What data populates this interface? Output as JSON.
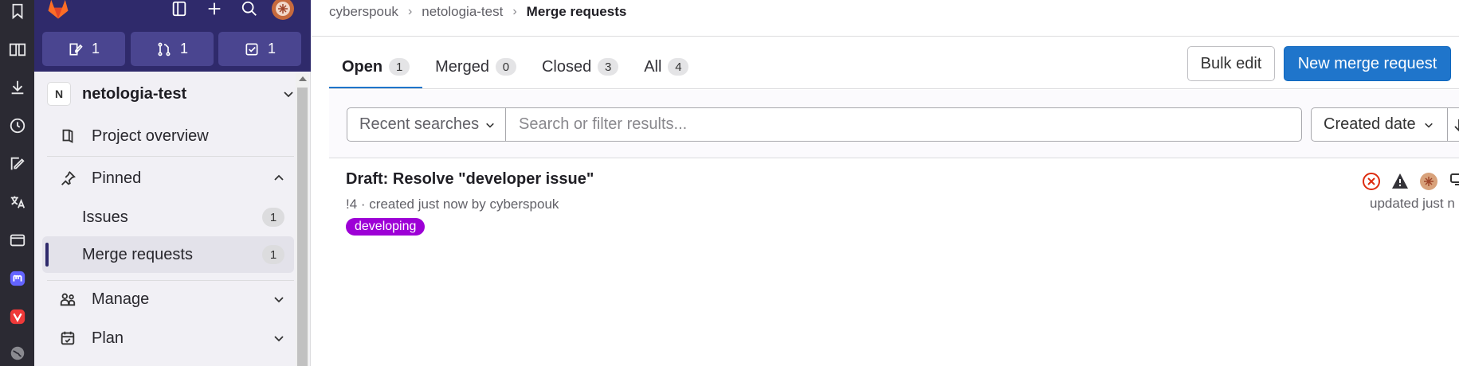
{
  "sidebar": {
    "counters": [
      {
        "icon": "issues-icon",
        "count": "1"
      },
      {
        "icon": "merge-request-icon",
        "count": "1"
      },
      {
        "icon": "todo-icon",
        "count": "1"
      }
    ],
    "project": {
      "avatar_letter": "N",
      "name": "netologia-test"
    },
    "items": {
      "overview": "Project overview",
      "pinned": "Pinned",
      "issues": "Issues",
      "issues_count": "1",
      "merge_requests": "Merge requests",
      "merge_requests_count": "1",
      "manage": "Manage",
      "plan": "Plan"
    }
  },
  "breadcrumb": [
    "cyberspouk",
    "netologia-test",
    "Merge requests"
  ],
  "tabs": [
    {
      "label": "Open",
      "count": "1"
    },
    {
      "label": "Merged",
      "count": "0"
    },
    {
      "label": "Closed",
      "count": "3"
    },
    {
      "label": "All",
      "count": "4"
    }
  ],
  "buttons": {
    "bulk_edit": "Bulk edit",
    "new_mr": "New merge request"
  },
  "filter": {
    "recent": "Recent searches",
    "search_placeholder": "Search or filter results...",
    "sort": "Created date"
  },
  "merge_request": {
    "title": "Draft: Resolve \"developer issue\"",
    "meta": "!4 · created just now by cyberspouk",
    "label": "developing",
    "updated": "updated just n"
  },
  "colors": {
    "brand": "#2f2a6b",
    "accent": "#1f75cb",
    "label": "#9d00d6"
  }
}
